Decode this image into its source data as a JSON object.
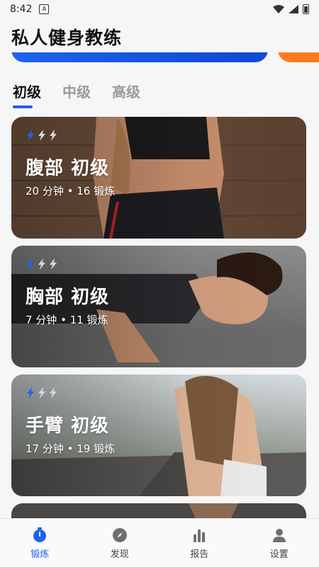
{
  "status": {
    "time": "8:42",
    "notif_glyph": "A"
  },
  "app": {
    "title": "私人健身教练"
  },
  "tabs": [
    {
      "label": "初级",
      "active": true
    },
    {
      "label": "中级",
      "active": false
    },
    {
      "label": "高级",
      "active": false
    }
  ],
  "workouts": [
    {
      "title": "腹部 初级",
      "subtitle": "20 分钟 • 16 锻炼",
      "level": 1
    },
    {
      "title": "胸部 初级",
      "subtitle": "7 分钟 • 11 锻炼",
      "level": 1
    },
    {
      "title": "手臂 初级",
      "subtitle": "17 分钟 • 19 锻炼",
      "level": 1
    }
  ],
  "nav": [
    {
      "label": "锻炼",
      "icon": "timer-icon",
      "active": true
    },
    {
      "label": "发现",
      "icon": "compass-icon",
      "active": false
    },
    {
      "label": "报告",
      "icon": "bar-chart-icon",
      "active": false
    },
    {
      "label": "设置",
      "icon": "person-icon",
      "active": false
    }
  ],
  "colors": {
    "accent": "#1d63f0",
    "orange": "#ff7a1f",
    "bolt_active": "#1d63f0",
    "bolt_inactive": "#d8d8d8"
  }
}
